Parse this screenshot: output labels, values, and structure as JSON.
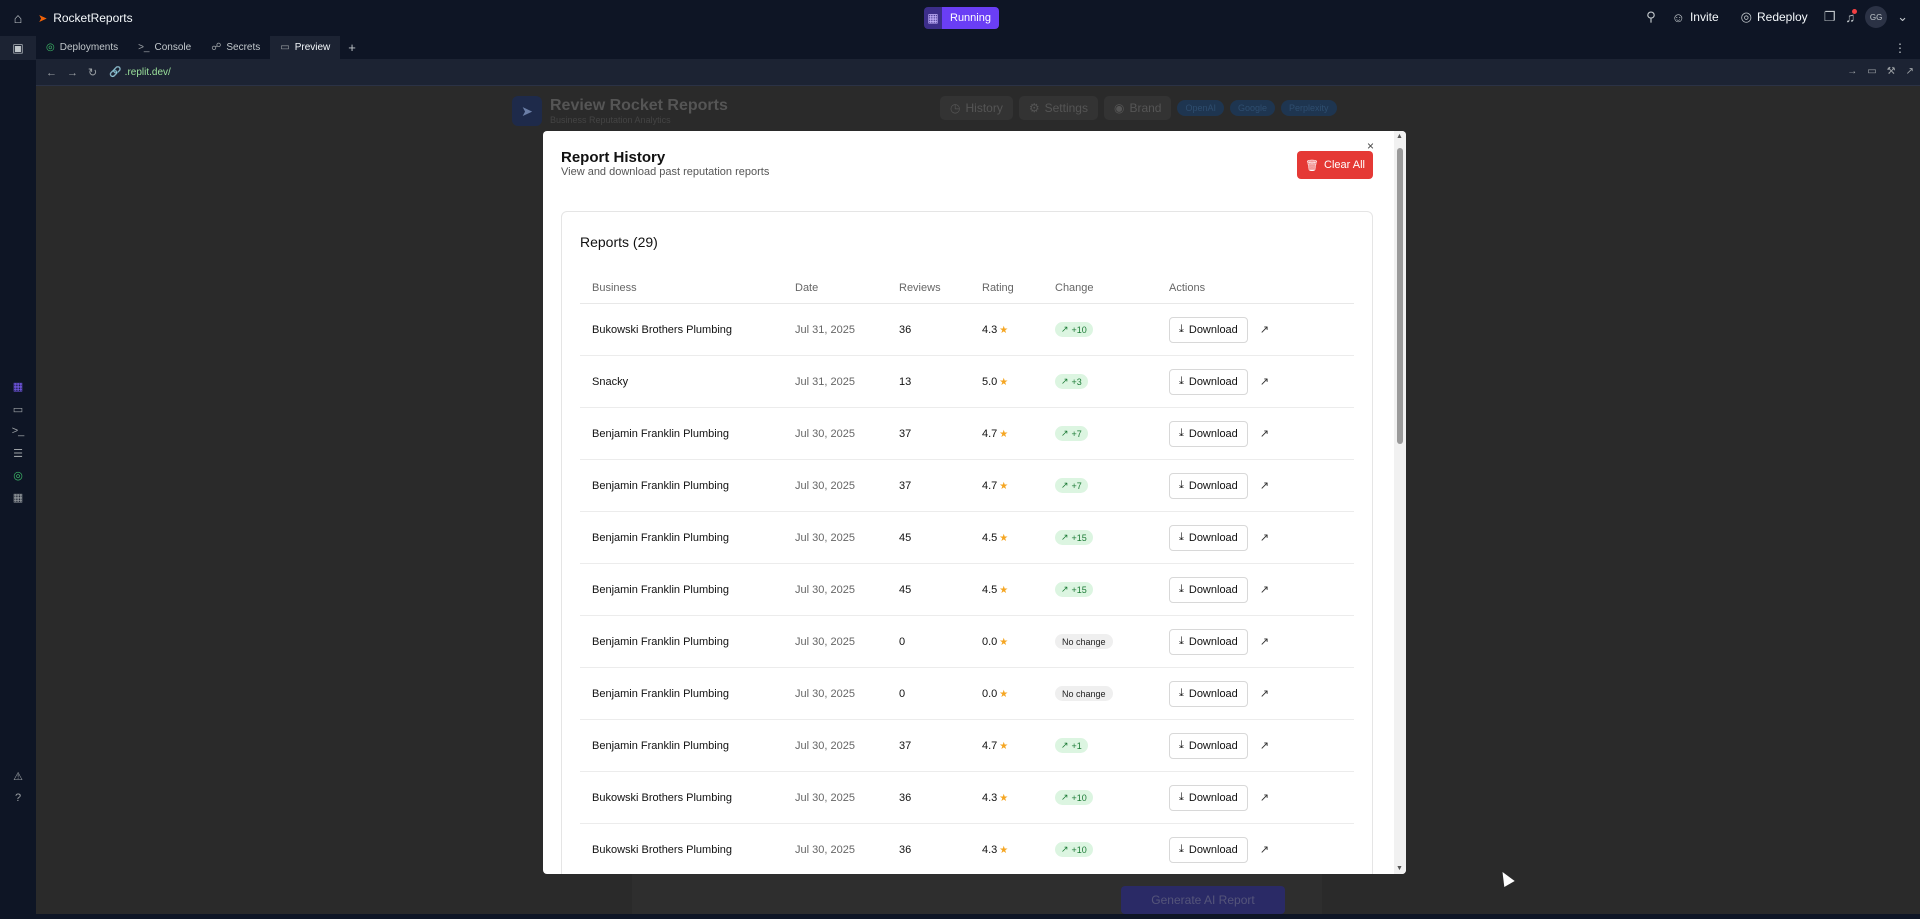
{
  "topbar": {
    "app_name": "RocketReports",
    "run_label": "Running",
    "invite_label": "Invite",
    "redeploy_label": "Redeploy",
    "avatar_initials": "GG"
  },
  "tabs": [
    {
      "label": "Deployments",
      "icon": "deployments-icon"
    },
    {
      "label": "Console",
      "icon": "console-icon"
    },
    {
      "label": "Secrets",
      "icon": "lock-icon"
    },
    {
      "label": "Preview",
      "icon": "monitor-icon"
    }
  ],
  "url": ".replit.dev/",
  "background": {
    "title": "Review Rocket Reports",
    "subtitle": "Business Reputation Analytics",
    "nav": {
      "history": "History",
      "settings": "Settings",
      "brand": "Brand"
    },
    "chips": [
      "OpenAI",
      "Google",
      "Perplexity"
    ],
    "generate_label": "Generate AI Report"
  },
  "modal": {
    "title": "Report History",
    "subtitle": "View and download past reputation reports",
    "clear_label": "Clear All",
    "card_title": "Reports (29)",
    "columns": [
      "Business",
      "Date",
      "Reviews",
      "Rating",
      "Change",
      "Actions"
    ],
    "download_label": "Download",
    "rows": [
      {
        "business": "Bukowski Brothers Plumbing",
        "date": "Jul 31, 2025",
        "reviews": "36",
        "rating": "4.3",
        "change": "+10",
        "trend": "up"
      },
      {
        "business": "Snacky",
        "date": "Jul 31, 2025",
        "reviews": "13",
        "rating": "5.0",
        "change": "+3",
        "trend": "up"
      },
      {
        "business": "Benjamin Franklin Plumbing",
        "date": "Jul 30, 2025",
        "reviews": "37",
        "rating": "4.7",
        "change": "+7",
        "trend": "up"
      },
      {
        "business": "Benjamin Franklin Plumbing",
        "date": "Jul 30, 2025",
        "reviews": "37",
        "rating": "4.7",
        "change": "+7",
        "trend": "up"
      },
      {
        "business": "Benjamin Franklin Plumbing",
        "date": "Jul 30, 2025",
        "reviews": "45",
        "rating": "4.5",
        "change": "+15",
        "trend": "up"
      },
      {
        "business": "Benjamin Franklin Plumbing",
        "date": "Jul 30, 2025",
        "reviews": "45",
        "rating": "4.5",
        "change": "+15",
        "trend": "up"
      },
      {
        "business": "Benjamin Franklin Plumbing",
        "date": "Jul 30, 2025",
        "reviews": "0",
        "rating": "0.0",
        "change": "No change",
        "trend": "none"
      },
      {
        "business": "Benjamin Franklin Plumbing",
        "date": "Jul 30, 2025",
        "reviews": "0",
        "rating": "0.0",
        "change": "No change",
        "trend": "none"
      },
      {
        "business": "Benjamin Franklin Plumbing",
        "date": "Jul 30, 2025",
        "reviews": "37",
        "rating": "4.7",
        "change": "+1",
        "trend": "up"
      },
      {
        "business": "Bukowski Brothers Plumbing",
        "date": "Jul 30, 2025",
        "reviews": "36",
        "rating": "4.3",
        "change": "+10",
        "trend": "up"
      },
      {
        "business": "Bukowski Brothers Plumbing",
        "date": "Jul 30, 2025",
        "reviews": "36",
        "rating": "4.3",
        "change": "+10",
        "trend": "up"
      }
    ]
  },
  "colors": {
    "accent": "#6a3ef5",
    "danger": "#e53935",
    "positive_bg": "#dcf5e1",
    "star": "#f5a623"
  }
}
